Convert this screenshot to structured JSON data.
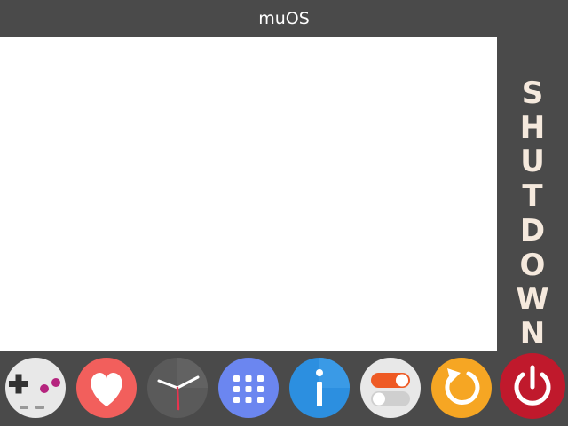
{
  "window": {
    "title": "muOS"
  },
  "side_panel": {
    "label": "SHUTDOWN"
  },
  "dock": {
    "items": [
      {
        "id": "games",
        "icon": "gamepad-icon",
        "color": "#e8e8e8"
      },
      {
        "id": "favourites",
        "icon": "heart-icon",
        "color": "#f25f5c"
      },
      {
        "id": "clock",
        "icon": "clock-icon",
        "color": "#5a5a5a"
      },
      {
        "id": "apps",
        "icon": "app-grid-icon",
        "color": "#6b86f0"
      },
      {
        "id": "info",
        "icon": "info-icon",
        "color": "#2c8fe0"
      },
      {
        "id": "configuration",
        "icon": "toggle-icon",
        "color": "#e8e8e8"
      },
      {
        "id": "reboot",
        "icon": "reboot-icon",
        "color": "#f6a623"
      },
      {
        "id": "shutdown",
        "icon": "power-icon",
        "color": "#c0192c"
      }
    ]
  }
}
